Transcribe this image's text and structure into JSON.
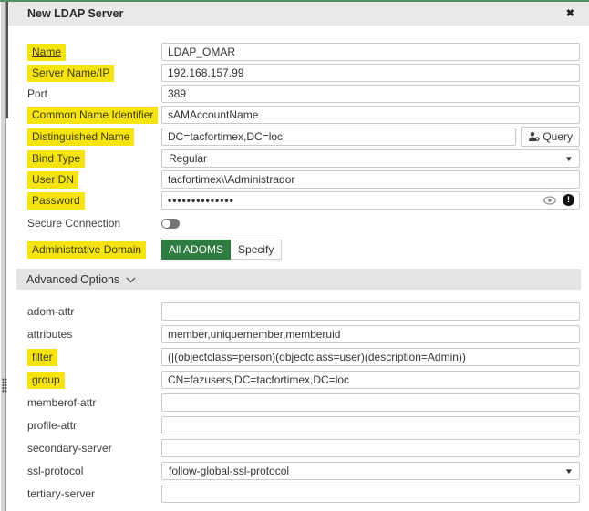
{
  "dialog": {
    "title": "New LDAP Server",
    "close_glyph": "✖"
  },
  "colors": {
    "accent_green": "#4f9160",
    "highlight_yellow": "#f6e411",
    "adom_selected_green": "#2f7c40",
    "titlebar_gray": "#e9e9e9"
  },
  "fields": {
    "name": {
      "label": "Name",
      "value": "LDAP_OMAR",
      "highlighted": "yes"
    },
    "server": {
      "label": "Server Name/IP",
      "value": "192.168.157.99",
      "highlighted": "yes"
    },
    "port": {
      "label": "Port",
      "value": "389",
      "highlighted": "no"
    },
    "cnid": {
      "label": "Common Name Identifier",
      "value": "sAMAccountName",
      "highlighted": "yes"
    },
    "dn": {
      "label": "Distinguished Name",
      "value": "DC=tacfortimex,DC=loc",
      "highlighted": "yes",
      "query_label": "Query"
    },
    "bind_type": {
      "label": "Bind Type",
      "value": "Regular",
      "highlighted": "yes",
      "caret": "▼"
    },
    "user_dn": {
      "label": "User DN",
      "value": "tacfortimex\\\\Administrador",
      "highlighted": "yes"
    },
    "password": {
      "label": "Password",
      "value": "••••••••••••••",
      "highlighted": "yes",
      "alert_glyph": "!"
    },
    "secure": {
      "label": "Secure Connection",
      "state": "off",
      "highlighted": "no"
    },
    "admin_domain": {
      "label": "Administrative Domain",
      "highlighted": "yes",
      "option_all": "All ADOMS",
      "option_specify": "Specify",
      "selected": "All ADOMS"
    }
  },
  "advanced": {
    "title": "Advanced Options",
    "expanded": "yes",
    "adom_attr": {
      "label": "adom-attr",
      "value": ""
    },
    "attributes": {
      "label": "attributes",
      "value": "member,uniquemember,memberuid"
    },
    "filter": {
      "label": "filter",
      "value": "(|(objectclass=person)(objectclass=user)(description=Admin))",
      "highlighted": "yes"
    },
    "group": {
      "label": "group",
      "value": "CN=fazusers,DC=tacfortimex,DC=loc",
      "highlighted": "yes"
    },
    "memberof_attr": {
      "label": "memberof-attr",
      "value": ""
    },
    "profile_attr": {
      "label": "profile-attr",
      "value": ""
    },
    "secondary_server": {
      "label": "secondary-server",
      "value": ""
    },
    "ssl_protocol": {
      "label": "ssl-protocol",
      "value": "follow-global-ssl-protocol",
      "caret": "▼"
    },
    "tertiary_server": {
      "label": "tertiary-server",
      "value": ""
    }
  }
}
